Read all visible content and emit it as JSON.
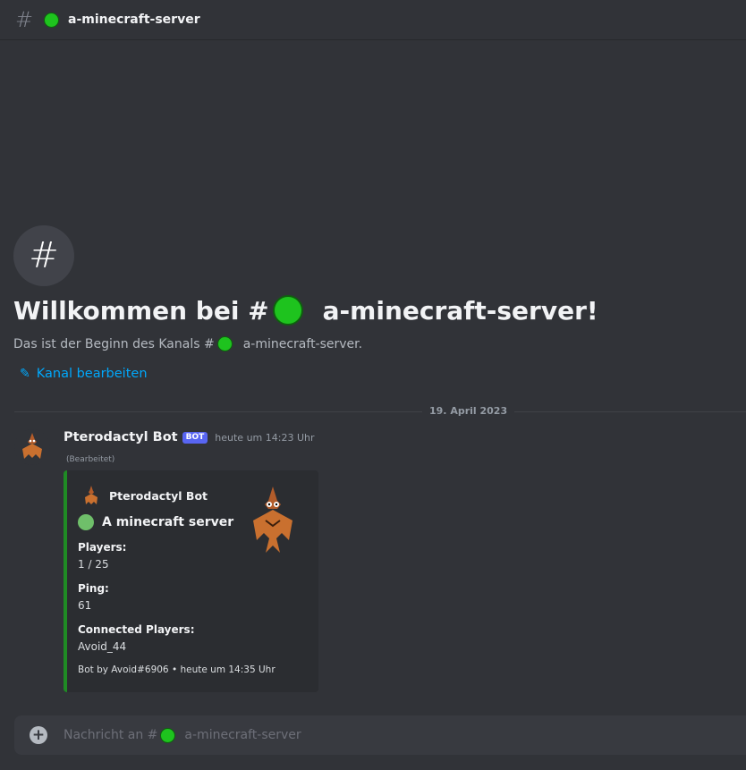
{
  "channel": {
    "hash": "#",
    "name": "a-minecraft-server"
  },
  "welcome": {
    "title_prefix": "Willkommen bei #",
    "title_suffix": "a-minecraft-server!",
    "subtitle_prefix": "Das ist der Beginn des Kanals #",
    "subtitle_suffix": "a-minecraft-server.",
    "edit_label": "Kanal bearbeiten"
  },
  "divider": {
    "date": "19. April 2023"
  },
  "message": {
    "author": "Pterodactyl Bot",
    "badge": "BOT",
    "timestamp": "heute um 14:23 Uhr",
    "edited": "(Bearbeitet)",
    "embed": {
      "author": "Pterodactyl Bot",
      "title": "A minecraft server",
      "fields": [
        {
          "name": "Players:",
          "value": "1 / 25"
        },
        {
          "name": "Ping:",
          "value": "61"
        },
        {
          "name": "Connected Players:",
          "value": "Avoid_44"
        }
      ],
      "footer": "Bot by Avoid#6906 • heute um 14:35 Uhr",
      "accent_color": "#1f8b24"
    }
  },
  "composer": {
    "placeholder_prefix": "Nachricht an #",
    "placeholder_suffix": "a-minecraft-server"
  },
  "colors": {
    "status_green": "#1ec31e",
    "link": "#00a8fc",
    "bot_badge": "#5865f2"
  }
}
